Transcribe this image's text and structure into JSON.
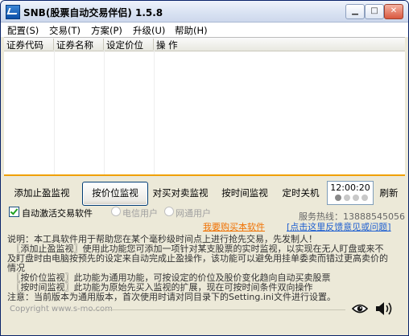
{
  "window": {
    "title": "SNB(股票自动交易伴侣) 1.5.8"
  },
  "menu": [
    "配置(S)",
    "交易(T)",
    "方案(P)",
    "升级(U)",
    "帮助(H)"
  ],
  "table": {
    "columns": [
      "证券代码",
      "证券名称",
      "设定价位",
      "操 作"
    ]
  },
  "buttons": {
    "stop_profit": "添加止盈监视",
    "price": "按价位监视",
    "pair": "对买对卖监视",
    "time": "按时间监视",
    "shutdown": "定时关机",
    "refresh": "刷新"
  },
  "clock": {
    "time": "12:00:20",
    "dots_on": 1,
    "dots_total": 4
  },
  "options": {
    "auto_trade_label": "自动激活交易软件",
    "auto_trade_checked": true,
    "telecom_label": "电信用户",
    "netcom_label": "网通用户"
  },
  "hotline": "服务热线：13888545056",
  "links": {
    "buy": "我要购买本软件",
    "feedback": "[点击这里反馈意见或问题]"
  },
  "description": [
    "说明：本工具软件用于帮助您在某个毫秒级时间点上进行抢先交易，先发制人！",
    "　〖添加止盈监视〗使用此功能您可添加一项针对某支股票的实时监视，以实现在无人盯盘或来不",
    "及盯盘时由电脑按预先的设定来自动完成止盈操作，该功能可以避免用挂单委卖而错过更高卖价的",
    "情况",
    "　〖按价位监视〗此功能为通用功能，可按设定的价位及股价变化趋向自动买卖股票",
    "　〖按时间监视〗此功能为原始先买入监视的扩展，现在可按时间条件双向操作",
    "注意：当前版本为通用版本，首次使用时请对同目录下的Setting.ini文件进行设置。"
  ],
  "copyright": "Copyright www.s-mo.com",
  "icons": {
    "eye": "eye-icon",
    "speaker": "speaker-icon"
  },
  "colors": {
    "accent_line": "#f0a000",
    "link_orange": "#f07000",
    "link_blue": "#2060d0"
  }
}
